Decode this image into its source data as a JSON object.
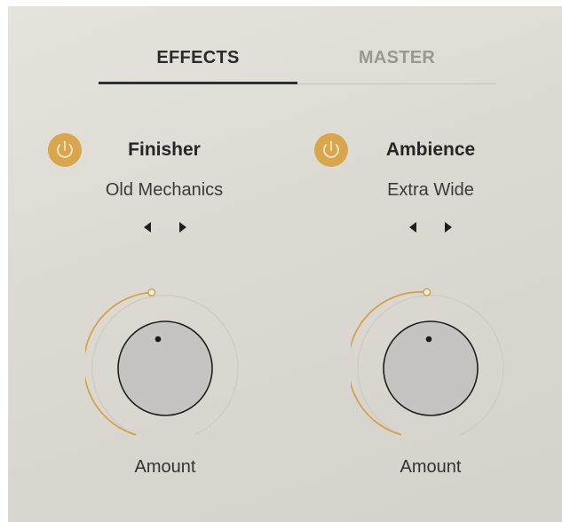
{
  "tabs": {
    "effects_label": "EFFECTS",
    "master_label": "MASTER",
    "active": "EFFECTS"
  },
  "slots": [
    {
      "name": "Finisher",
      "preset": "Old Mechanics",
      "power_on": true,
      "knob_label": "Amount",
      "knob_value": 0.5
    },
    {
      "name": "Ambience",
      "preset": "Extra Wide",
      "power_on": true,
      "knob_label": "Amount",
      "knob_value": 0.5
    }
  ],
  "colors": {
    "accent": "#d9a650",
    "text_primary": "#262626",
    "text_inactive": "#9a9893",
    "knob_face": "#c4c3c0",
    "panel_bg": "#dedbd4"
  },
  "icons": {
    "power": "power-icon",
    "prev": "triangle-left-icon",
    "next": "triangle-right-icon",
    "knob_indicator": "dot-icon"
  }
}
